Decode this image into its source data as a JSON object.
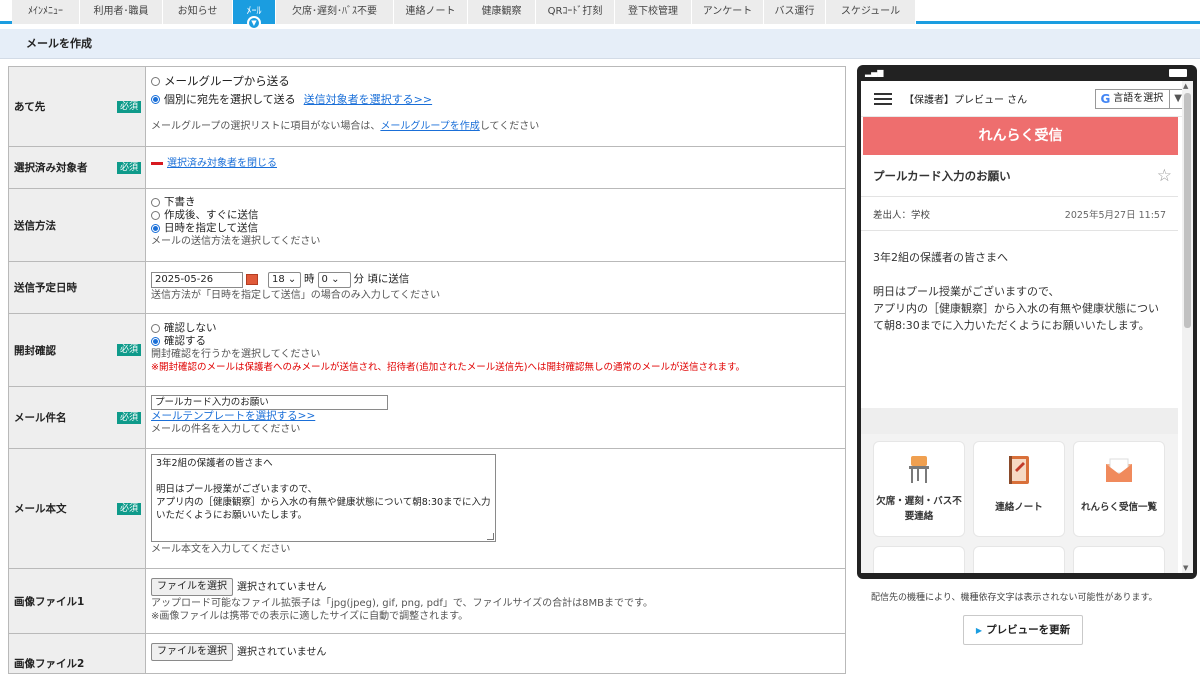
{
  "nav": {
    "tabs": [
      {
        "label": "ﾒｲﾝﾒﾆｭｰ"
      },
      {
        "label": "利用者･職員"
      },
      {
        "label": "お知らせ"
      },
      {
        "label": "ﾒｰﾙ"
      },
      {
        "label": "欠席･遅刻･ﾊﾞｽ不要"
      },
      {
        "label": "連絡ノート"
      },
      {
        "label": "健康観察"
      },
      {
        "label": "QRｺｰﾄﾞ打刻"
      },
      {
        "label": "登下校管理"
      },
      {
        "label": "アンケート"
      },
      {
        "label": "バス運行"
      },
      {
        "label": "スケジュール"
      }
    ]
  },
  "page": {
    "title": "メールを作成"
  },
  "form": {
    "required_label": "必須",
    "recipient": {
      "label": "あて先",
      "opt_group": "メールグループから送る",
      "opt_individual": "個別に宛先を選択して送る",
      "select_link": "送信対象者を選択する>>",
      "hint_pre": "メールグループの選択リストに項目がない場合は、",
      "hint_link": "メールグループを作成",
      "hint_post": "してください"
    },
    "selected": {
      "label": "選択済み対象者",
      "toggle_link": "選択済み対象者を閉じる"
    },
    "send_method": {
      "label": "送信方法",
      "opt_draft": "下書き",
      "opt_now": "作成後、すぐに送信",
      "opt_scheduled": "日時を指定して送信",
      "hint": "メールの送信方法を選択してください"
    },
    "schedule": {
      "label": "送信予定日時",
      "date": "2025-05-26",
      "hour": "18",
      "hour_unit": "時",
      "minute": "0",
      "minute_suffix": "分 頃に送信",
      "hint": "送信方法が「日時を指定して送信」の場合のみ入力してください"
    },
    "read_confirm": {
      "label": "開封確認",
      "opt_no": "確認しない",
      "opt_yes": "確認する",
      "hint": "開封確認を行うかを選択してください",
      "warning": "※開封確認のメールは保護者へのみメールが送信され、招待者(追加されたメール送信先)へは開封確認無しの通常のメールが送信されます。"
    },
    "subject": {
      "label": "メール件名",
      "value": "プールカード入力のお願い",
      "template_link": "メールテンプレートを選択する>>",
      "hint": "メールの件名を入力してください"
    },
    "body": {
      "label": "メール本文",
      "value": "3年2組の保護者の皆さまへ\n\n明日はプール授業がございますので、\nアプリ内の［健康観察］から入水の有無や健康状態について朝8:30までに入力いただくようにお願いいたします。",
      "hint": "メール本文を入力してください"
    },
    "image1": {
      "label": "画像ファイル1",
      "button": "ファイルを選択",
      "status": "選択されていません",
      "hint1": "アップロード可能なファイル拡張子は「jpg(jpeg), gif, png, pdf」で、ファイルサイズの合計は8MBまでです。",
      "hint2": "※画像ファイルは携帯での表示に適したサイズに自動で調整されます。"
    },
    "image2": {
      "label": "画像ファイル2",
      "button": "ファイルを選択",
      "status": "選択されていません"
    }
  },
  "preview": {
    "viewer": "【保護者】プレビュー さん",
    "language_button": "言語を選択",
    "header": "れんらく受信",
    "mail_title": "プールカード入力のお願い",
    "sender": "差出人：学校",
    "date": "2025年5月27日 11:57",
    "body": "3年2組の保護者の皆さまへ\n\n明日はプール授業がございますので、\nアプリ内の［健康観察］から入水の有無や健康状態について朝8:30までに入力いただくようにお願いいたします。",
    "tiles": [
      {
        "label": "欠席・遅刻・バス不要連絡",
        "icon": "desk-chair-icon"
      },
      {
        "label": "連絡ノート",
        "icon": "notebook-icon"
      },
      {
        "label": "れんらく受信一覧",
        "icon": "envelope-icon"
      }
    ],
    "note": "配信先の機種により、機種依存文字は表示されない可能性があります。",
    "refresh_button": "プレビューを更新"
  },
  "colors": {
    "accent": "#1b9de0",
    "required_badge": "#0e9a8a",
    "preview_header": "#ee6e6e",
    "warning": "#e00000",
    "link": "#1a6fd8"
  }
}
